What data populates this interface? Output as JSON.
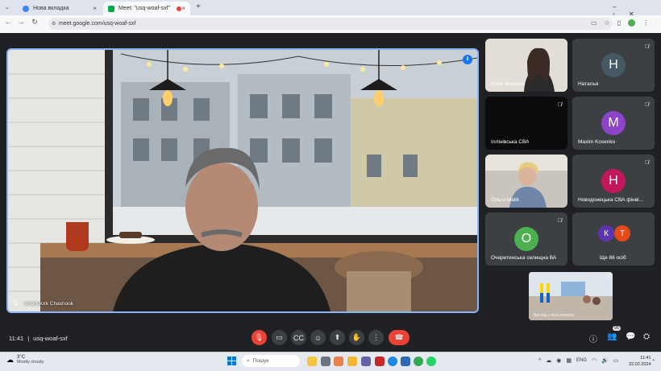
{
  "browser": {
    "tabs": [
      {
        "label": "Нова вкладка",
        "close": "×"
      },
      {
        "label": "Meet: \"usq-woaf-sxf\"",
        "close": "×"
      }
    ],
    "new_tab": "+",
    "url": "meet.google.com/usq-woaf-sxf"
  },
  "meet": {
    "main_speaker": "smartwork Chasnook",
    "time": "11:41",
    "separator": "|",
    "meeting_code": "usq-woaf-sxf",
    "participant_count": "95",
    "participants": [
      {
        "name": "Юлія Фесенко",
        "type": "video"
      },
      {
        "name": "Наталья",
        "type": "avatar",
        "initial": "Н",
        "color": "#455a64"
      },
      {
        "name": "Іллінівська СВА",
        "type": "dark"
      },
      {
        "name": "Maxim Kosenko",
        "type": "avatar",
        "initial": "M",
        "color": "#8e44c8"
      },
      {
        "name": "Ольга Malik",
        "type": "video"
      },
      {
        "name": "Новодонецька СВА фінві...",
        "type": "avatar",
        "initial": "Н",
        "color": "#c2185b"
      },
      {
        "name": "Очеретинська селищна ВА",
        "type": "avatar",
        "initial": "О",
        "color": "#4caf50"
      },
      {
        "name": "Ще 86 осіб",
        "type": "more",
        "initials": [
          "К",
          "Т"
        ],
        "colors": [
          "#5e35b1",
          "#e64a19"
        ]
      }
    ],
    "self_view_label": "Вигляд з моєї камери"
  },
  "taskbar": {
    "weather_temp": "3°C",
    "weather_desc": "Mostly cloudy",
    "search_placeholder": "Пошук",
    "lang": "ENG",
    "clock_time": "11:41",
    "clock_date": "22.02.2024"
  }
}
